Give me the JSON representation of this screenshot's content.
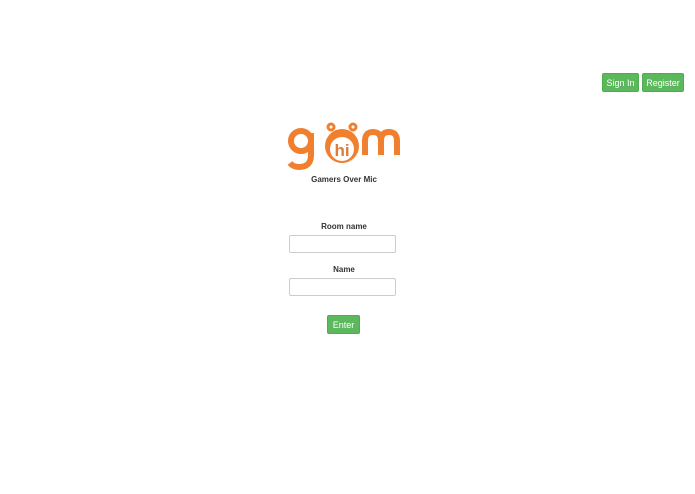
{
  "header": {
    "sign_in_label": "Sign In",
    "register_label": "Register"
  },
  "brand": {
    "logo_text": "gom",
    "logo_inner_text": "hi",
    "tagline": "Gamers Over Mic",
    "logo_color": "#f07f2e"
  },
  "form": {
    "room_label": "Room name",
    "room_value": "",
    "name_label": "Name",
    "name_value": "",
    "enter_label": "Enter"
  },
  "colors": {
    "button_green": "#5cb85c"
  }
}
